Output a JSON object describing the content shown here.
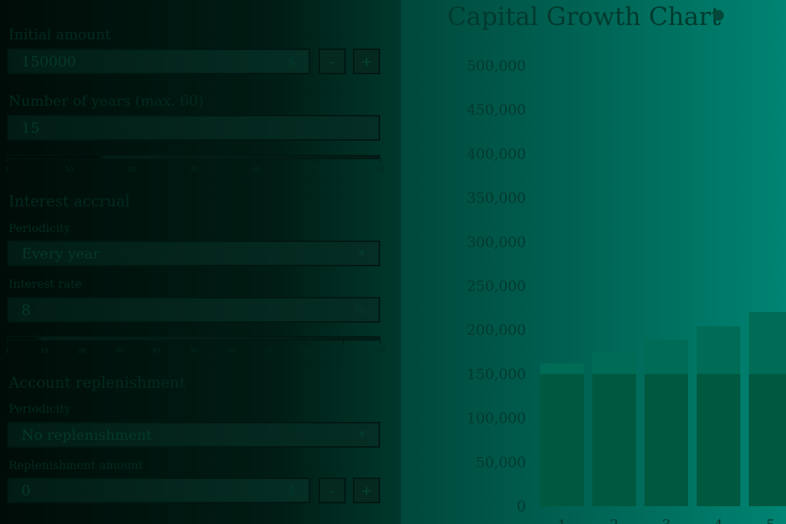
{
  "form": {
    "initial_amount": {
      "label": "Initial amount",
      "value": "150000",
      "currency": "$",
      "minus": "-",
      "plus": "+"
    },
    "years": {
      "label": "Number of years (max. 60)",
      "value": "15",
      "slider_fraction": 0.25,
      "ticks": [
        "1",
        "10",
        "20",
        "30",
        "40",
        "50",
        "60"
      ]
    },
    "interest": {
      "section": "Interest accrual",
      "periodicity_label": "Periodicity",
      "periodicity_value": "Every year",
      "rate_label": "Interest rate",
      "rate_value": "8",
      "rate_unit": "%",
      "rate_slider_fraction": 0.08,
      "ticks": [
        "1",
        "10",
        "20",
        "30",
        "40",
        "50",
        "60",
        "70",
        "80",
        "90",
        "100"
      ]
    },
    "replenishment": {
      "section": "Account replenishment",
      "periodicity_label": "Periodicity",
      "periodicity_value": "No replenishment",
      "amount_label": "Replenishment amount",
      "amount_value": "0",
      "currency": "$",
      "minus": "-",
      "plus": "+"
    }
  },
  "chart_data": {
    "type": "bar",
    "title": "Capital Growth Chart",
    "categories": [
      "1",
      "2",
      "3",
      "4",
      "5"
    ],
    "series": [
      {
        "values": [
          150000,
          150000,
          150000,
          150000,
          150000
        ]
      },
      {
        "values": [
          12000,
          24960,
          38957,
          54073,
          70399
        ]
      }
    ],
    "yticks": [
      0,
      50000,
      100000,
      150000,
      200000,
      250000,
      300000,
      350000,
      400000,
      450000,
      500000
    ],
    "ylim": [
      0,
      500000
    ],
    "colors": {
      "base": "#00583f",
      "interest": "#006c55"
    }
  }
}
